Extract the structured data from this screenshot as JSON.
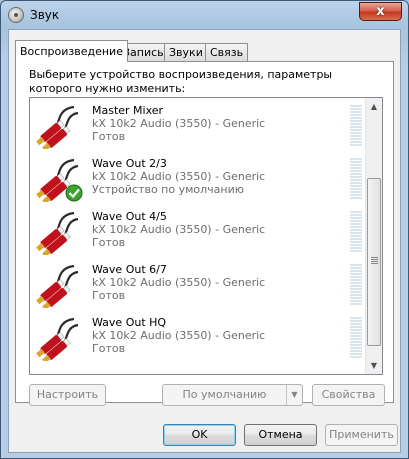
{
  "window": {
    "title": "Звук",
    "close_glyph": "x",
    "icon": "speaker-icon"
  },
  "tabs": [
    {
      "label": "Воспроизведение",
      "active": true
    },
    {
      "label": "Запись",
      "active": false
    },
    {
      "label": "Звуки",
      "active": false
    },
    {
      "label": "Связь",
      "active": false
    }
  ],
  "playback": {
    "description": "Выберите устройство воспроизведения, параметры которого нужно изменить:",
    "devices": [
      {
        "name": "Master Mixer",
        "driver": "kX 10k2 Audio (3550) - Generic",
        "status": "Готов",
        "is_default": false
      },
      {
        "name": "Wave Out 2/3",
        "driver": "kX 10k2 Audio (3550) - Generic",
        "status": "Устройство по умолчанию",
        "is_default": true
      },
      {
        "name": "Wave Out 4/5",
        "driver": "kX 10k2 Audio (3550) - Generic",
        "status": "Готов",
        "is_default": false
      },
      {
        "name": "Wave Out 6/7",
        "driver": "kX 10k2 Audio (3550) - Generic",
        "status": "Готов",
        "is_default": false
      },
      {
        "name": "Wave Out HQ",
        "driver": "kX 10k2 Audio (3550) - Generic",
        "status": "Готов",
        "is_default": false
      }
    ],
    "configure_label": "Настроить",
    "set_default_label": "По умолчанию",
    "properties_label": "Свойства"
  },
  "dialog_buttons": {
    "ok_label": "OK",
    "cancel_label": "Отмена",
    "apply_label": "Применить"
  },
  "colors": {
    "default_check": "#3aa331",
    "plug_red": "#c0121c",
    "plug_gold": "#d9a62a"
  }
}
